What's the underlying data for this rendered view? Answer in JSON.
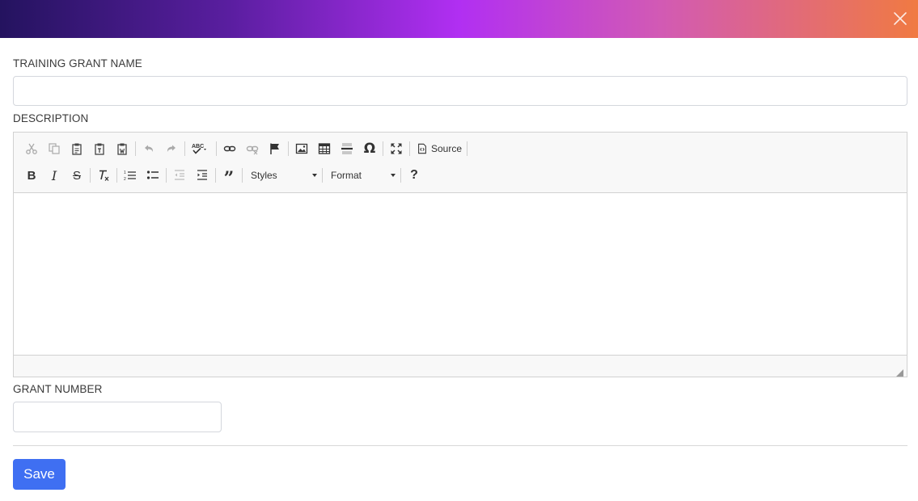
{
  "form": {
    "name_label": "TRAINING GRANT NAME",
    "name_value": "",
    "description_label": "DESCRIPTION",
    "grant_number_label": "GRANT NUMBER",
    "grant_number_value": "",
    "save_label": "Save"
  },
  "editor": {
    "source_label": "Source",
    "styles_label": "Styles",
    "format_label": "Format",
    "content": ""
  },
  "colors": {
    "header_gradient": [
      "#24135f",
      "#b12ff2",
      "#f07a42"
    ],
    "primary_button": "#3f6ff2"
  }
}
